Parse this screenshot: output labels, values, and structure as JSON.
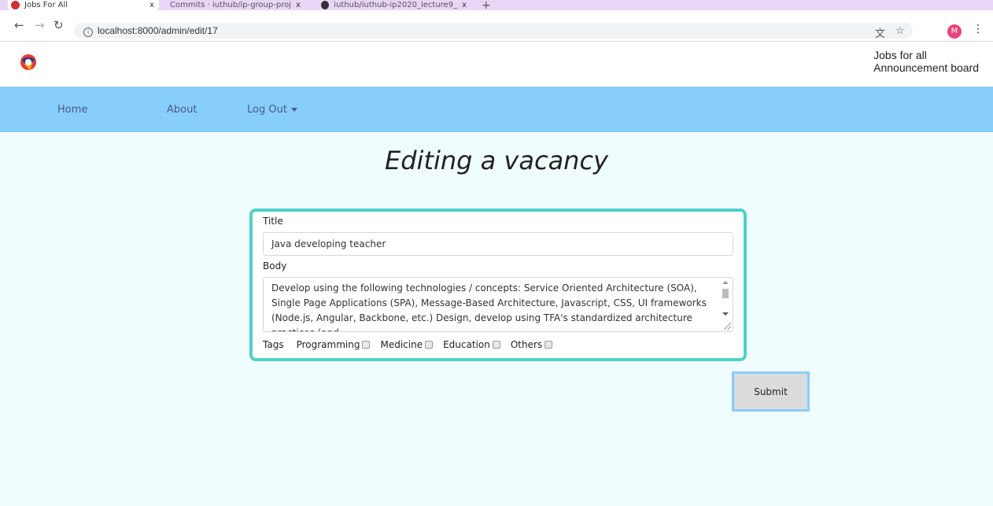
{
  "browser": {
    "tabs": [
      {
        "title": "Jobs For All",
        "close": "x"
      },
      {
        "title": "Commits · iuthub/ip-group-proj",
        "close": "x"
      },
      {
        "title": "iuthub/iuthub-ip2020_lecture9_",
        "close": "x"
      }
    ],
    "new_tab": "+",
    "url": "localhost:8000/admin/edit/17",
    "profile_initial": "M",
    "icons": [
      "back-icon",
      "forward-icon",
      "reload-icon",
      "info-icon",
      "translate-icon",
      "star-icon",
      "menu-icon"
    ]
  },
  "header": {
    "brand_line1": "Jobs for all",
    "brand_line2": "Announcement board"
  },
  "nav": {
    "home": "Home",
    "about": "About",
    "logout": "Log Out"
  },
  "page": {
    "title": "Editing a vacancy"
  },
  "form": {
    "title_label": "Title",
    "title_value": "Java developing teacher",
    "body_label": "Body",
    "body_value": "Develop using the following technologies / concepts: Service Oriented Architecture (SOA), Single Page Applications (SPA), Message-Based Architecture, Javascript, CSS, UI frameworks (Node.js, Angular, Backbone, etc.) Design, develop using TFA's standardized architecture practices (and",
    "tags_label": "Tags",
    "tags": [
      "Programming",
      "Medicine",
      "Education",
      "Others"
    ],
    "submit_label": "Submit"
  },
  "colors": {
    "page_bg": "#f0fdff",
    "navbar_bg": "#87cefa",
    "form_border": "#4fd1c5",
    "submit_bg": "#dcdcdc"
  }
}
